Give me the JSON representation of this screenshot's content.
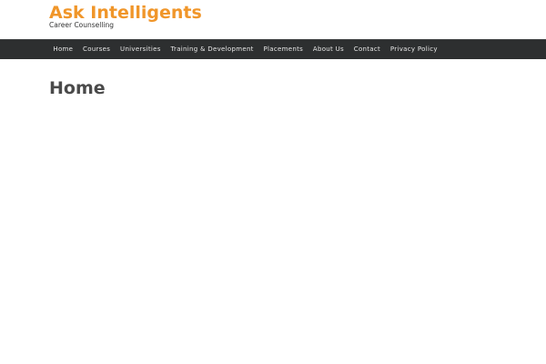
{
  "site": {
    "title": "Ask Intelligents",
    "tagline": "Career Counselling"
  },
  "nav": {
    "items": [
      {
        "label": "Home"
      },
      {
        "label": "Courses"
      },
      {
        "label": "Universities"
      },
      {
        "label": "Training & Development"
      },
      {
        "label": "Placements"
      },
      {
        "label": "About Us"
      },
      {
        "label": "Contact"
      },
      {
        "label": "Privacy Policy"
      }
    ]
  },
  "main": {
    "page_title": "Home"
  },
  "colors": {
    "accent": "#f0962a",
    "nav_background": "#2d2f30",
    "heading": "#4a4a4a"
  }
}
